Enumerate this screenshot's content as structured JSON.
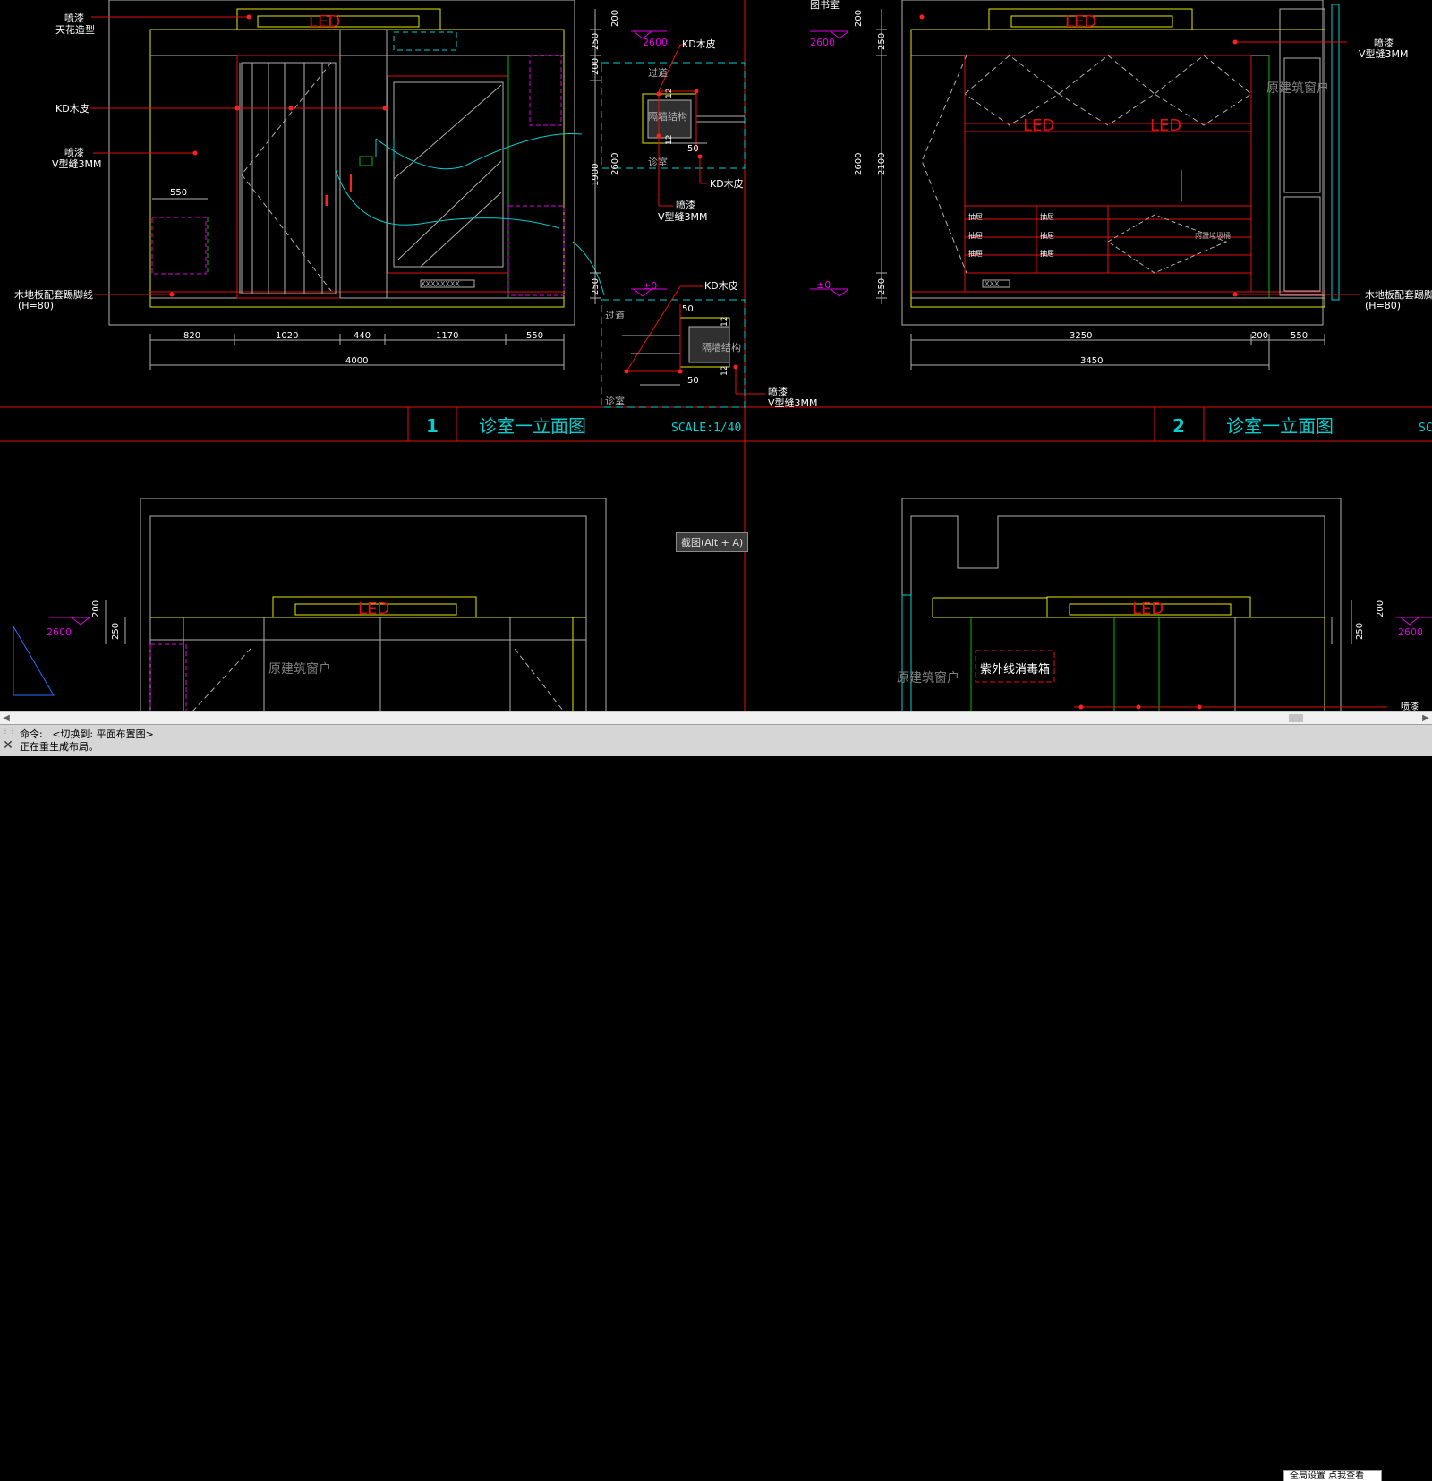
{
  "canvas": {
    "background": "#000000",
    "colors": {
      "red": "#e01010",
      "yellow": "#e6e600",
      "cyan": "#00d0d0",
      "white": "#ffffff",
      "magenta": "#e000e0",
      "green": "#00c000",
      "grey": "#b0b0b0",
      "brightred": "#ff2020"
    }
  },
  "drawing": {
    "elevations": [
      {
        "number": "1",
        "title": "诊室一立面图",
        "scale": "SCALE:1/40",
        "dims_bottom": [
          "820",
          "1020",
          "440",
          "1170",
          "550"
        ],
        "total": "4000",
        "dims_right": [
          "200",
          "250",
          "200",
          "1900",
          "2600",
          "250"
        ],
        "labels": [
          "喷漆",
          "天花造型",
          "KD木皮",
          "喷漆",
          "V型缝3MM",
          "木地板配套踢脚线",
          "(H=80)",
          "550"
        ],
        "pattern_text": "XXXXXXXX"
      },
      {
        "number": "2",
        "title": "诊室一立面图",
        "scale": "SC",
        "dims_bottom": [
          "3250",
          "200",
          "550"
        ],
        "total": "3450",
        "dims_left": [
          "200",
          "250",
          "2600",
          "2100",
          "250"
        ],
        "labels": [
          "喷漆",
          "V型缝3MM",
          "原建筑窗户",
          "木地板配套踢脚",
          "(H=80)",
          "抽屉",
          "抽屉",
          "抽屉",
          "抽屉",
          "抽屉",
          "抽屉",
          "内置垃圾桶",
          "图书室"
        ],
        "led": [
          "LED",
          "LED",
          "LED"
        ],
        "pattern_text": "XXX"
      }
    ],
    "details": {
      "top": {
        "level": "2600",
        "labels": [
          "KD木皮",
          "过道",
          "隔墙结构",
          "诊室",
          "KD木皮",
          "喷漆",
          "V型缝3MM"
        ],
        "dims": [
          "12",
          "12",
          "50"
        ]
      },
      "bottom": {
        "level": "±0",
        "labels": [
          "KD木皮",
          "过道",
          "隔墙结构",
          "诊室",
          "喷漆",
          "V型缝3MM"
        ],
        "dims": [
          "50",
          "12",
          "12",
          "50"
        ]
      },
      "level_right": "2600",
      "level_right_zero": "±0"
    },
    "lower": {
      "left": {
        "level": "2600",
        "dims": [
          "200",
          "250"
        ],
        "window_label": "原建筑窗户",
        "led": "LED"
      },
      "right": {
        "level": "2600",
        "dims": [
          "200",
          "250"
        ],
        "window_label": "原建筑窗户",
        "led": "LED",
        "uv_label": "紫外线消毒箱",
        "edge_label": "喷漆"
      }
    },
    "led_label": "LED"
  },
  "tooltip": "截图(Alt + A)",
  "command": {
    "line1": "命令:   <切换到: 平面布置图>",
    "line2": "正在重生成布局。",
    "popup": "全局设置  点我查看"
  }
}
